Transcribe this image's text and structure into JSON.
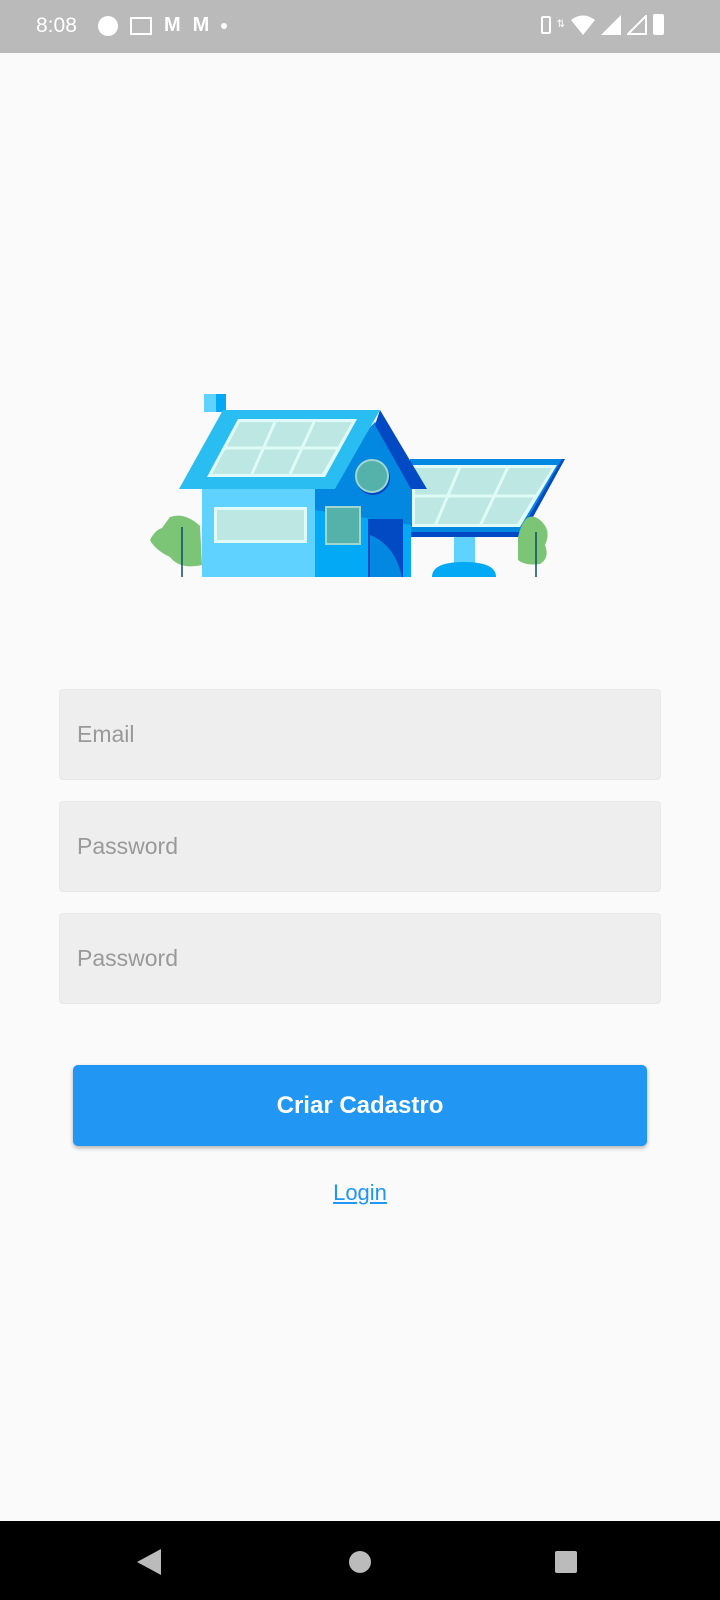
{
  "status_bar": {
    "time": "8:08",
    "left_icons": [
      "face-icon",
      "photo-icon",
      "gmail-icon",
      "gmail-icon",
      "dot-icon"
    ],
    "right_icons": [
      "vibrate-icon",
      "data-icon",
      "wifi-icon",
      "signal-icon",
      "signal-off-icon",
      "battery-icon"
    ]
  },
  "form": {
    "email_placeholder": "Email",
    "password_placeholder": "Password",
    "confirm_placeholder": "Password"
  },
  "submit_label": "Criar Cadastro",
  "login_link": "Login",
  "colors": {
    "accent": "#2196f3"
  }
}
